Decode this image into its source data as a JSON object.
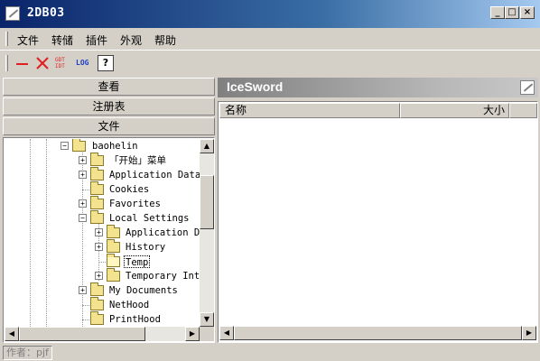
{
  "window": {
    "title": "2DB03"
  },
  "window_controls": {
    "minimize": "_",
    "maximize": "□",
    "close": "×"
  },
  "menu": [
    "文件",
    "转储",
    "插件",
    "外观",
    "帮助"
  ],
  "toolbar": {
    "gdt_label": "GDT\nIDT",
    "log_label": "LOG",
    "help_label": "?"
  },
  "left_tabs": [
    "查看",
    "注册表",
    "文件"
  ],
  "tree": [
    {
      "label": "baohelin",
      "expander": "−"
    },
    {
      "label": "「开始」菜单",
      "expander": "+"
    },
    {
      "label": "Application Data",
      "expander": "+"
    },
    {
      "label": "Cookies",
      "expander": ""
    },
    {
      "label": "Favorites",
      "expander": "+"
    },
    {
      "label": "Local Settings",
      "expander": "−"
    },
    {
      "label": "Application D",
      "expander": "+"
    },
    {
      "label": "History",
      "expander": "+"
    },
    {
      "label": "Temp",
      "expander": "",
      "selected": true
    },
    {
      "label": "Temporary Int",
      "expander": "+"
    },
    {
      "label": "My Documents",
      "expander": "+"
    },
    {
      "label": "NetHood",
      "expander": ""
    },
    {
      "label": "PrintHood",
      "expander": ""
    }
  ],
  "right_panel": {
    "title": "IceSword"
  },
  "columns": [
    "名称",
    "大小"
  ],
  "status": {
    "text": "作者：pjf"
  }
}
